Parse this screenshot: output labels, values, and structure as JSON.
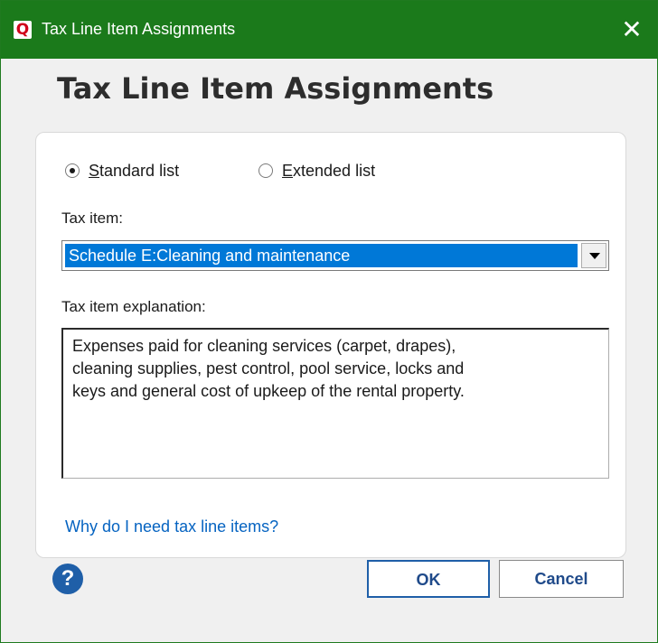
{
  "window": {
    "title": "Tax Line Item Assignments",
    "app_icon_letter": "Q",
    "close_glyph": "✕"
  },
  "heading": "Tax Line Item Assignments",
  "list_type": {
    "options": [
      {
        "label": "Standard list",
        "selected": true
      },
      {
        "label": "Extended list",
        "selected": false
      }
    ]
  },
  "tax_item": {
    "label": "Tax item:",
    "selected_value": "Schedule E:Cleaning and maintenance"
  },
  "explanation": {
    "label": "Tax item explanation:",
    "text": "Expenses paid for cleaning services (carpet, drapes),\ncleaning supplies, pest control, pool service, locks and\nkeys and general cost of upkeep of the rental property."
  },
  "help_link": "Why do I need tax line items?",
  "footer": {
    "help_glyph": "?",
    "ok_label": "OK",
    "cancel_label": "Cancel"
  },
  "colors": {
    "titlebar": "#1b7a1b",
    "selection": "#0078d7",
    "link": "#0563c1",
    "primary_button_border": "#1f5fa8"
  },
  "icons": [
    "app-logo-icon",
    "close-icon",
    "radio-icon",
    "dropdown-arrow-icon",
    "help-icon"
  ]
}
